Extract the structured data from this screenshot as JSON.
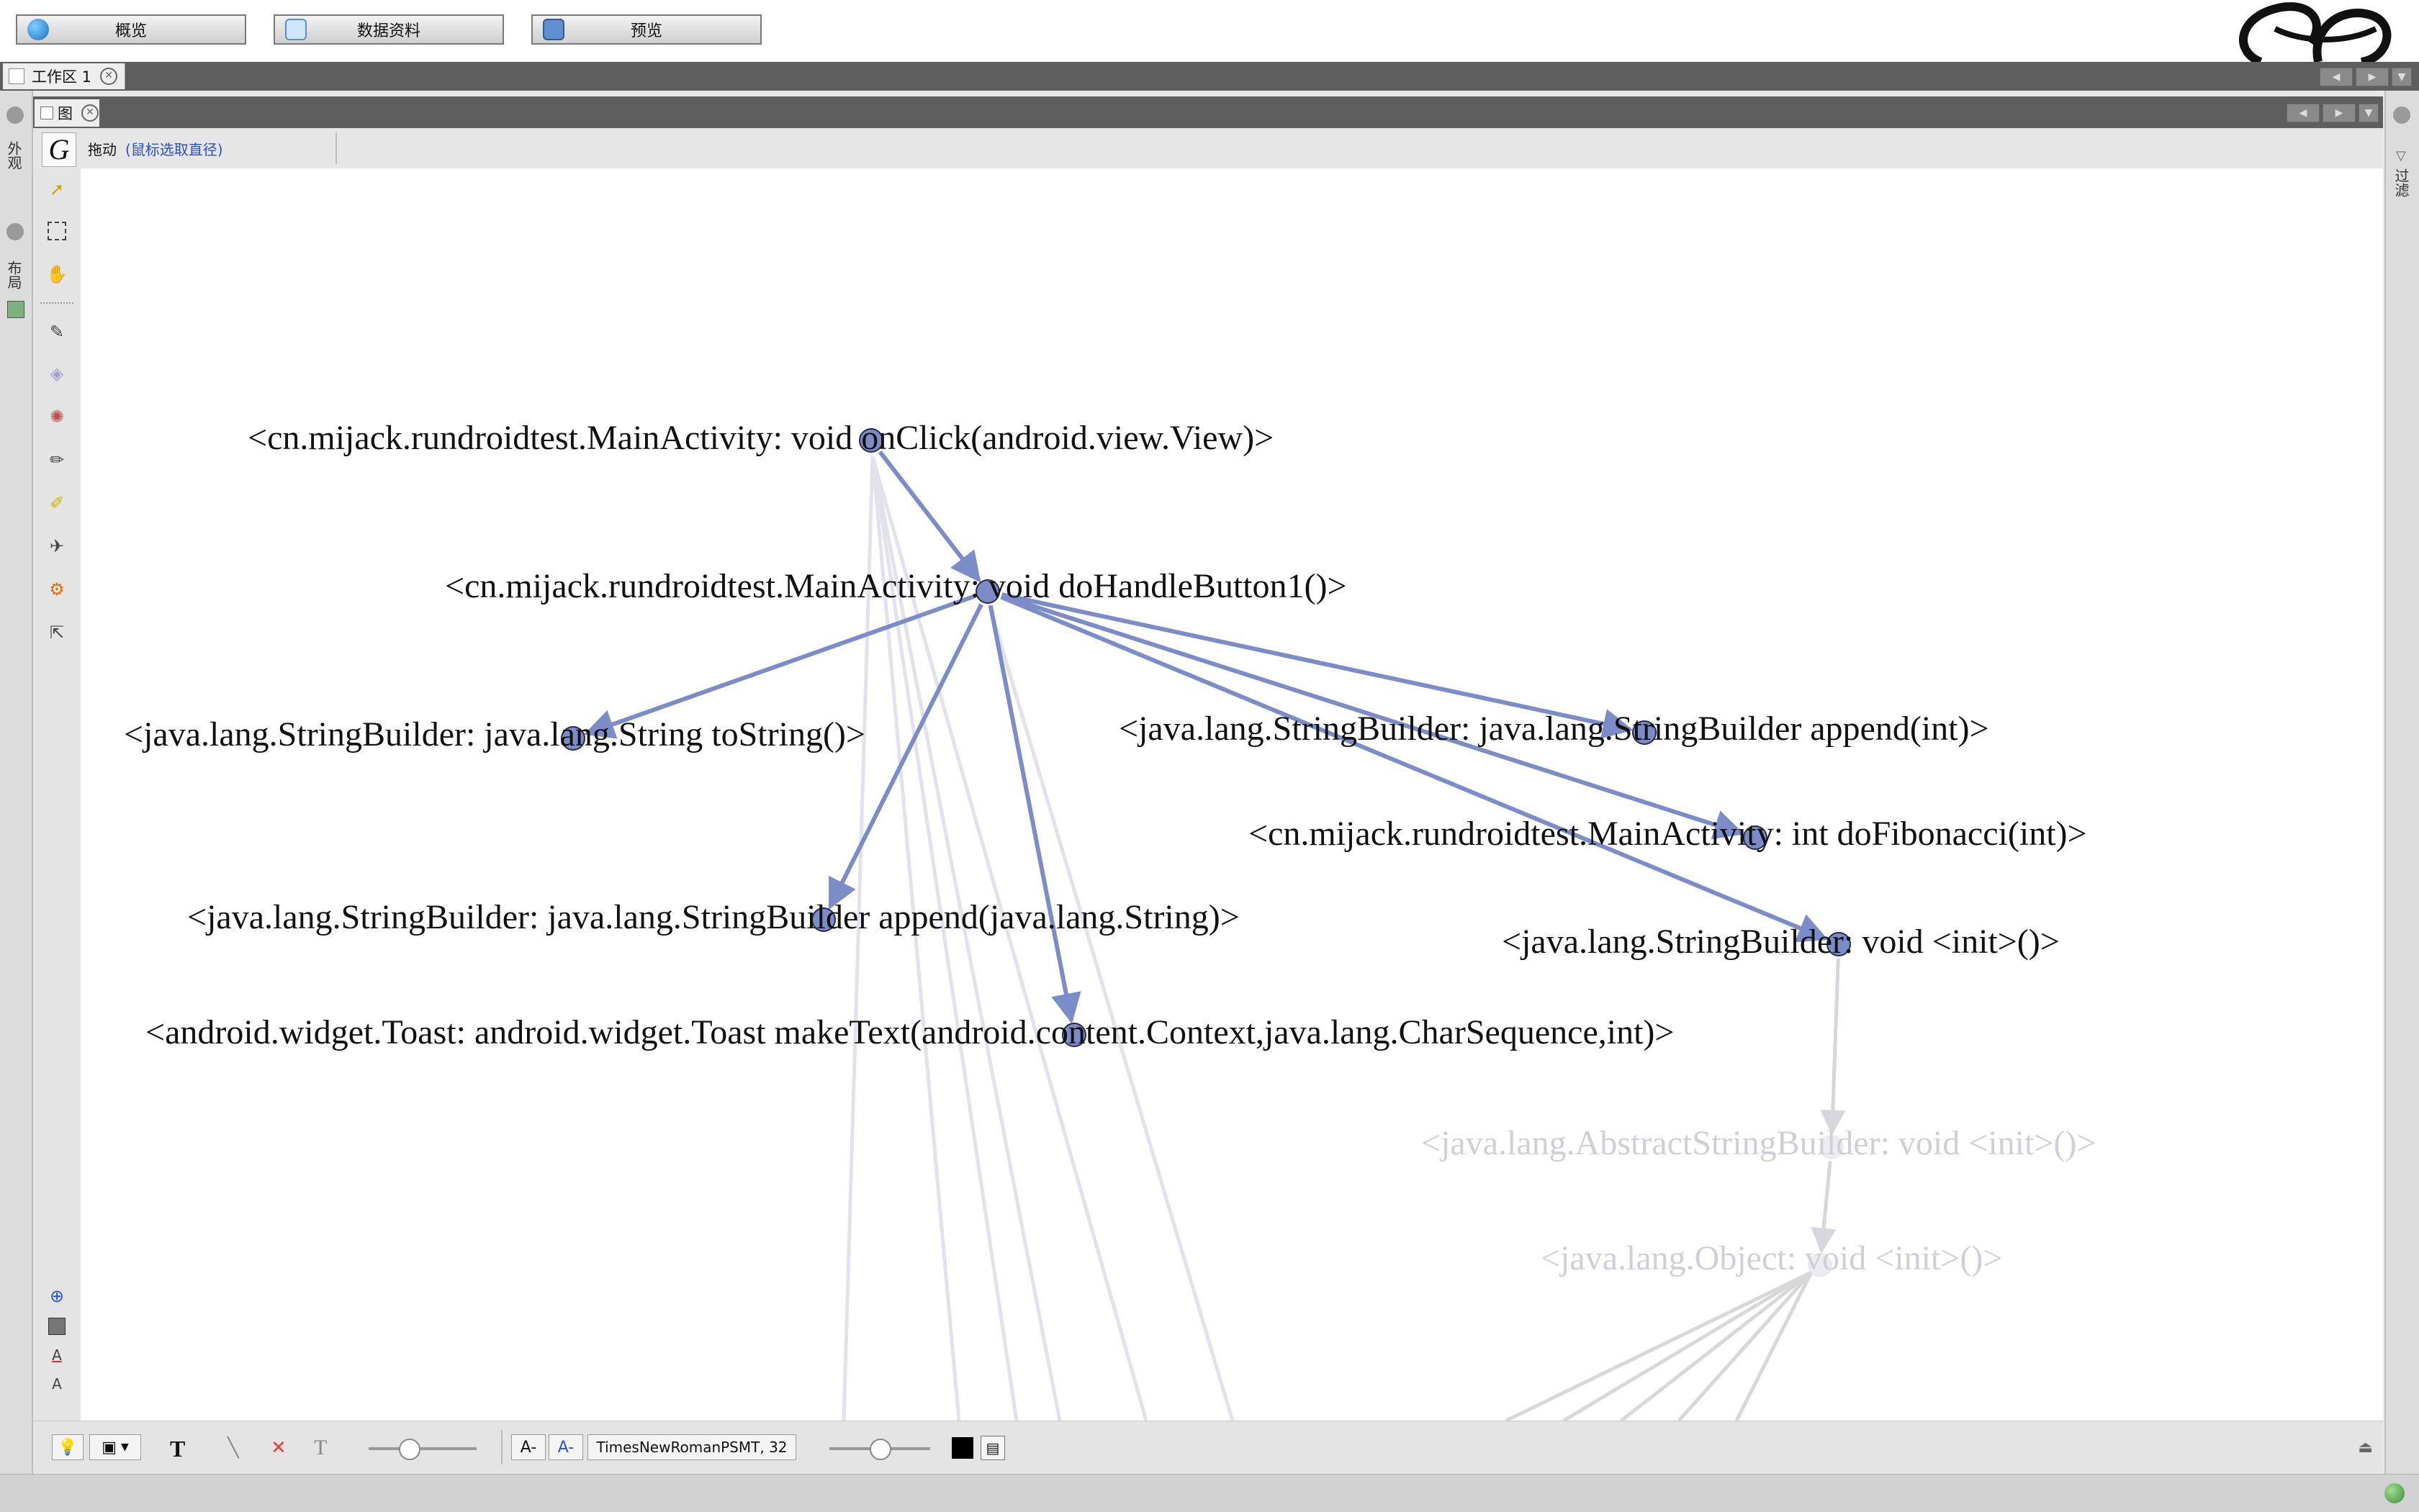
{
  "modes": [
    {
      "label": "概览",
      "icon": "globe-icon"
    },
    {
      "label": "数据资料",
      "icon": "table-icon"
    },
    {
      "label": "预览",
      "icon": "monitor-icon"
    }
  ],
  "workspace_tab": {
    "label": "工作区 1"
  },
  "left_panels": [
    {
      "label": "外观"
    },
    {
      "label": "布局"
    }
  ],
  "right_panels": [
    {
      "label": "过滤"
    }
  ],
  "graph_tab": {
    "label": "图"
  },
  "tool_header": {
    "tool_name": "拖动",
    "hint": "(鼠标选取直径)"
  },
  "bottom": {
    "font_label": "TimesNewRomanPSMT, 32"
  },
  "graph": {
    "nodes": [
      {
        "label": "<cn.mijack.rundroidtest.MainActivity: void onClick(android.view.View)>"
      },
      {
        "label": "<cn.mijack.rundroidtest.MainActivity: void doHandleButton1()>"
      },
      {
        "label": "<java.lang.StringBuilder: java.lang.String toString()>"
      },
      {
        "label": "<java.lang.StringBuilder: java.lang.StringBuilder append(int)>"
      },
      {
        "label": "<cn.mijack.rundroidtest.MainActivity: int doFibonacci(int)>"
      },
      {
        "label": "<java.lang.StringBuilder: java.lang.StringBuilder append(java.lang.String)>"
      },
      {
        "label": "<java.lang.StringBuilder: void <init>()>"
      },
      {
        "label": "<android.widget.Toast: android.widget.Toast makeText(android.content.Context,java.lang.CharSequence,int)>"
      },
      {
        "label": "<java.lang.AbstractStringBuilder: void <init>()>"
      },
      {
        "label": "<java.lang.Object: void <init>()>"
      }
    ],
    "edge_color": "#7b8cc8",
    "node_color": "#7b8cc8"
  }
}
